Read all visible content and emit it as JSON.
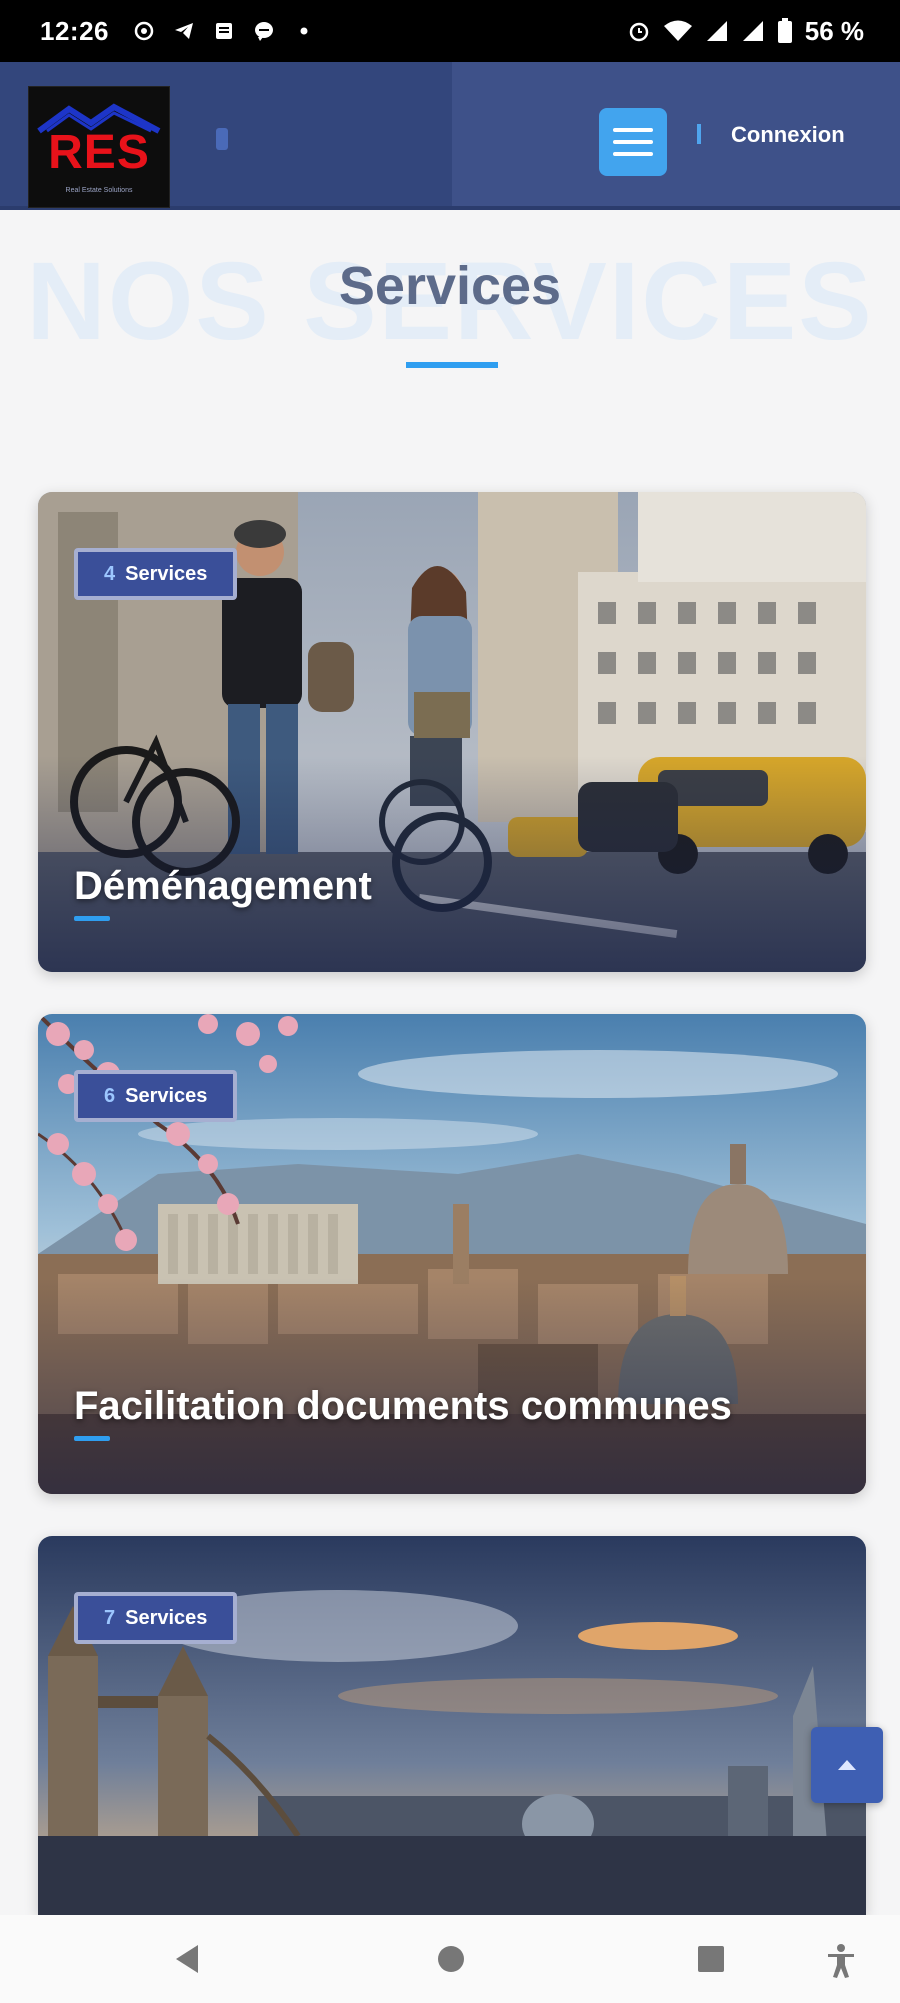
{
  "status_bar": {
    "time": "12:26",
    "battery": "56 %",
    "notification_icons": [
      "whatsapp-icon",
      "telegram-icon",
      "notes-icon",
      "messenger-icon",
      "dot-icon"
    ],
    "system_icons": [
      "alarm-icon",
      "wifi-icon",
      "signal-icon",
      "signal-icon",
      "battery-icon"
    ]
  },
  "header": {
    "logo_text": "RES",
    "logo_subtitle": "Real Estate Solutions",
    "menu_icon": "hamburger-menu-icon",
    "login_label": "Connexion"
  },
  "section": {
    "watermark": "NOS SERVICES",
    "title": "Services"
  },
  "cards": [
    {
      "count": "4",
      "count_label": "Services",
      "title": "Déménagement"
    },
    {
      "count": "6",
      "count_label": "Services",
      "title": "Facilitation documents communes"
    },
    {
      "count": "7",
      "count_label": "Services",
      "title": ""
    }
  ],
  "colors": {
    "header_bg": "#3e5189",
    "accent": "#2f9ef0",
    "badge_bg": "#3a4f99",
    "menu_button": "#42a4ee"
  },
  "nav_bar": {
    "back_icon": "back-icon",
    "home_icon": "home-icon",
    "recents_icon": "recents-icon",
    "accessibility_icon": "accessibility-icon"
  }
}
